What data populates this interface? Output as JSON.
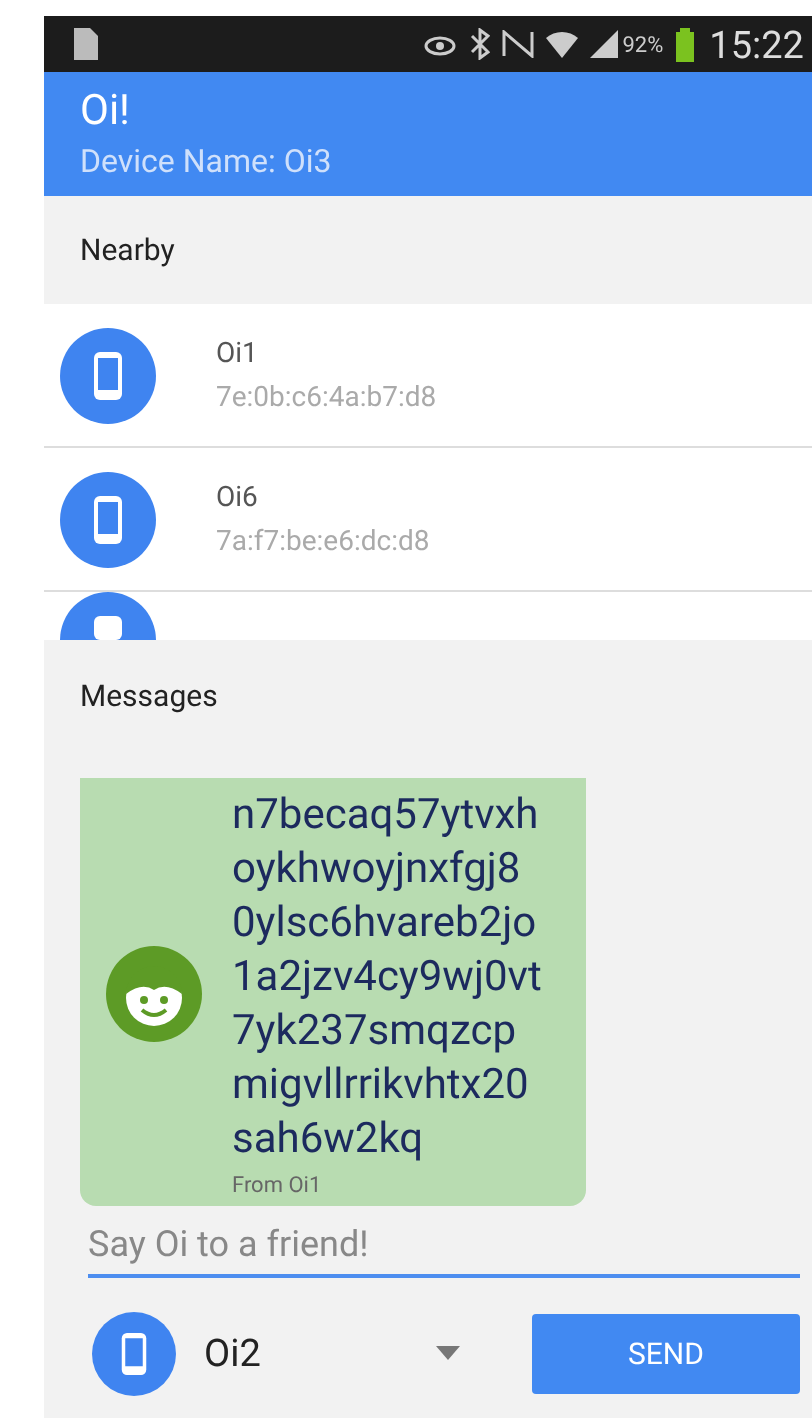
{
  "status_bar": {
    "battery_text": "92%",
    "time": "15:22"
  },
  "app_bar": {
    "title": "Oi!",
    "subtitle": "Device Name: Oi3"
  },
  "nearby": {
    "header": "Nearby",
    "devices": [
      {
        "name": "Oi1",
        "address": "7e:0b:c6:4a:b7:d8"
      },
      {
        "name": "Oi6",
        "address": "7a:f7:be:e6:dc:d8"
      }
    ]
  },
  "messages": {
    "header": "Messages",
    "items": [
      {
        "lines": [
          "n7becaq57ytvxh",
          "oykhwoyjnxfgj8",
          "0ylsc6hvareb2jo",
          "1a2jzv4cy9wj0vt",
          "7yk237smqzcp",
          "migvllrrikvhtx20",
          "sah6w2kq"
        ],
        "sender": "From Oi1"
      }
    ]
  },
  "composer": {
    "placeholder": "Say Oi to a friend!",
    "recipient": "Oi2",
    "send_label": "SEND"
  }
}
